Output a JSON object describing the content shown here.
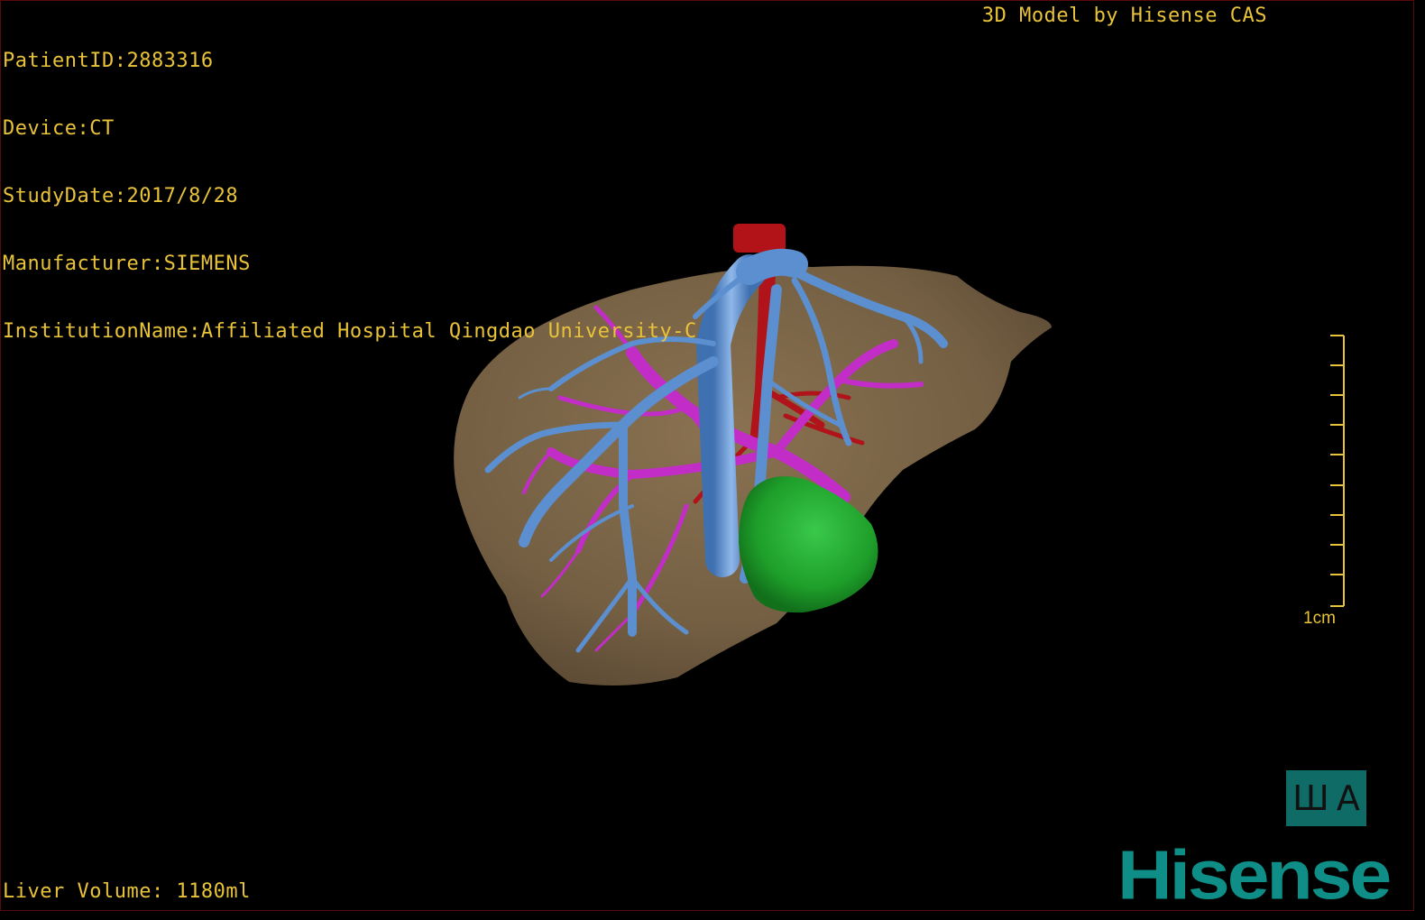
{
  "study_info": {
    "patient_id": "PatientID:2883316",
    "device": "Device:CT",
    "study_date": "StudyDate:2017/8/28",
    "manufacturer": "Manufacturer:SIEMENS",
    "institution": "InstitutionName:Affiliated Hospital Qingdao University-C"
  },
  "brand_caption": "3D Model by Hisense CAS",
  "liver_volume": "Liver Volume: 1180ml",
  "scale_bar": {
    "label": "1cm",
    "ticks": 10
  },
  "view_toggle": {
    "left_glyph": "Ш",
    "right_glyph": "A"
  },
  "logo": "Hisense",
  "colors": {
    "overlay_text": "#e8c33a",
    "liver": "#7a6447",
    "hepatic_vein": "#5b8fd0",
    "portal_vein": "#c22dc8",
    "artery": "#b0141a",
    "tumor": "#1e9e2a",
    "logo": "#0e8e86",
    "button": "#0f6b66"
  }
}
